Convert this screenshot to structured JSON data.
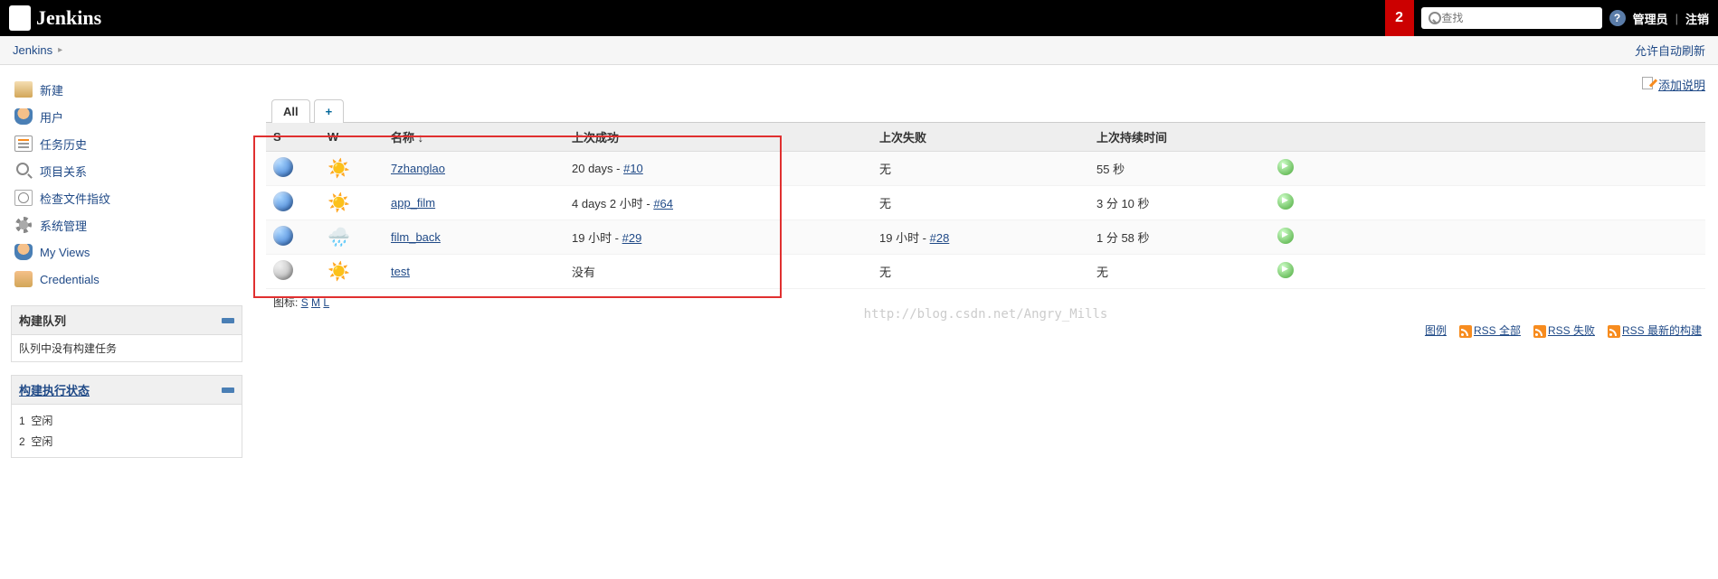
{
  "topbar": {
    "logo_text": "Jenkins",
    "notif_count": "2",
    "search_placeholder": "查找",
    "admin_label": "管理员",
    "logout_label": "注销"
  },
  "breadcrumb": {
    "root": "Jenkins",
    "auto_refresh": "允许自动刷新"
  },
  "sidebar": {
    "tasks": [
      {
        "label": "新建",
        "icon": "new"
      },
      {
        "label": "用户",
        "icon": "user"
      },
      {
        "label": "任务历史",
        "icon": "history"
      },
      {
        "label": "项目关系",
        "icon": "search"
      },
      {
        "label": "检查文件指纹",
        "icon": "finger"
      },
      {
        "label": "系统管理",
        "icon": "gear"
      },
      {
        "label": "My Views",
        "icon": "user"
      },
      {
        "label": "Credentials",
        "icon": "cred"
      }
    ],
    "queue_header": "构建队列",
    "queue_empty": "队列中没有构建任务",
    "executor_header": "构建执行状态",
    "executors": [
      {
        "num": "1",
        "status": "空闲"
      },
      {
        "num": "2",
        "status": "空闲"
      }
    ]
  },
  "main": {
    "add_description": "添加说明",
    "tabs": {
      "all": "All"
    },
    "columns": {
      "s": "S",
      "w": "W",
      "name": "名称",
      "name_sort": "↓",
      "last_success": "上次成功",
      "last_failure": "上次失败",
      "last_duration": "上次持续时间"
    },
    "jobs": [
      {
        "status": "blue",
        "weather": "sun",
        "name": "7zhanglao",
        "success_text": "20 days - ",
        "success_link": "#10",
        "failure_text": "无",
        "failure_link": "",
        "duration": "55 秒"
      },
      {
        "status": "blue",
        "weather": "sun",
        "name": "app_film",
        "success_text": "4 days 2 小时 - ",
        "success_link": "#64",
        "failure_text": "无",
        "failure_link": "",
        "duration": "3 分 10 秒"
      },
      {
        "status": "blue",
        "weather": "rain",
        "name": "film_back",
        "success_text": "19 小时 - ",
        "success_link": "#29",
        "failure_text": "19 小时 - ",
        "failure_link": "#28",
        "duration": "1 分 58 秒"
      },
      {
        "status": "grey",
        "weather": "sun",
        "name": "test",
        "success_text": "没有",
        "success_link": "",
        "failure_text": "无",
        "failure_link": "",
        "duration": "无"
      }
    ],
    "icon_size_label": "图标:",
    "icon_sizes": [
      "S",
      "M",
      "L"
    ],
    "footer": {
      "legend": "图例",
      "rss_all": "RSS 全部",
      "rss_fail": "RSS 失败",
      "rss_latest": "RSS 最新的构建"
    }
  },
  "watermark": "http://blog.csdn.net/Angry_Mills"
}
